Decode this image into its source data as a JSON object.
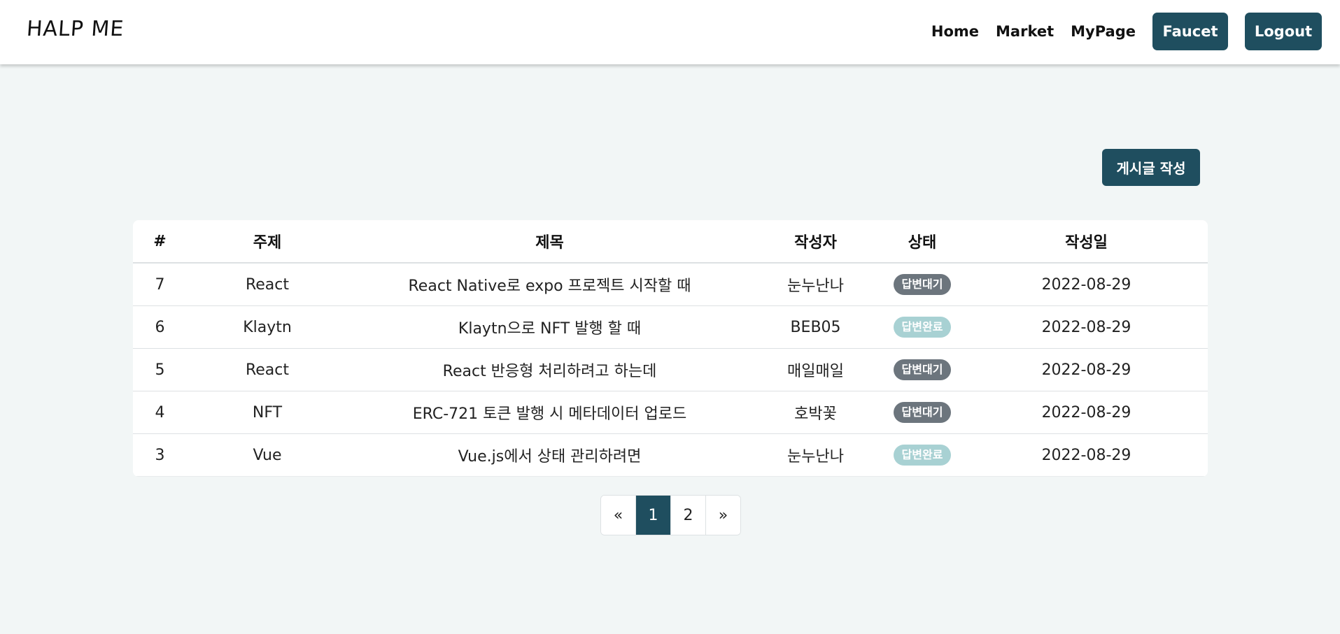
{
  "navbar": {
    "brand": "HALP ME",
    "links": [
      "Home",
      "Market",
      "MyPage"
    ],
    "faucet_label": "Faucet",
    "logout_label": "Logout"
  },
  "board": {
    "write_label": "게시글 작성",
    "columns": [
      "#",
      "주제",
      "제목",
      "작성자",
      "상태",
      "작성일"
    ],
    "rows": [
      {
        "num": "7",
        "topic": "React",
        "title": "React Native로 expo 프로젝트 시작할 때",
        "author": "눈누난나",
        "status": "답변대기",
        "status_type": "waiting",
        "date": "2022-08-29"
      },
      {
        "num": "6",
        "topic": "Klaytn",
        "title": "Klaytn으로 NFT 발행 할 때",
        "author": "BEB05",
        "status": "답변완료",
        "status_type": "done",
        "date": "2022-08-29"
      },
      {
        "num": "5",
        "topic": "React",
        "title": "React 반응형 처리하려고 하는데",
        "author": "매일매일",
        "status": "답변대기",
        "status_type": "waiting",
        "date": "2022-08-29"
      },
      {
        "num": "4",
        "topic": "NFT",
        "title": "ERC-721 토큰 발행 시 메타데이터 업로드",
        "author": "호박꽃",
        "status": "답변대기",
        "status_type": "waiting",
        "date": "2022-08-29"
      },
      {
        "num": "3",
        "topic": "Vue",
        "title": "Vue.js에서 상태 관리하려면",
        "author": "눈누난나",
        "status": "답변완료",
        "status_type": "done",
        "date": "2022-08-29"
      }
    ]
  },
  "pagination": {
    "prev": "«",
    "pages": [
      "1",
      "2"
    ],
    "current": "1",
    "next": "»"
  },
  "colors": {
    "primary": "#1f4e5f",
    "background": "#f2f6f6",
    "badge_waiting": "#6c757d",
    "badge_done": "#a8d1d3"
  }
}
